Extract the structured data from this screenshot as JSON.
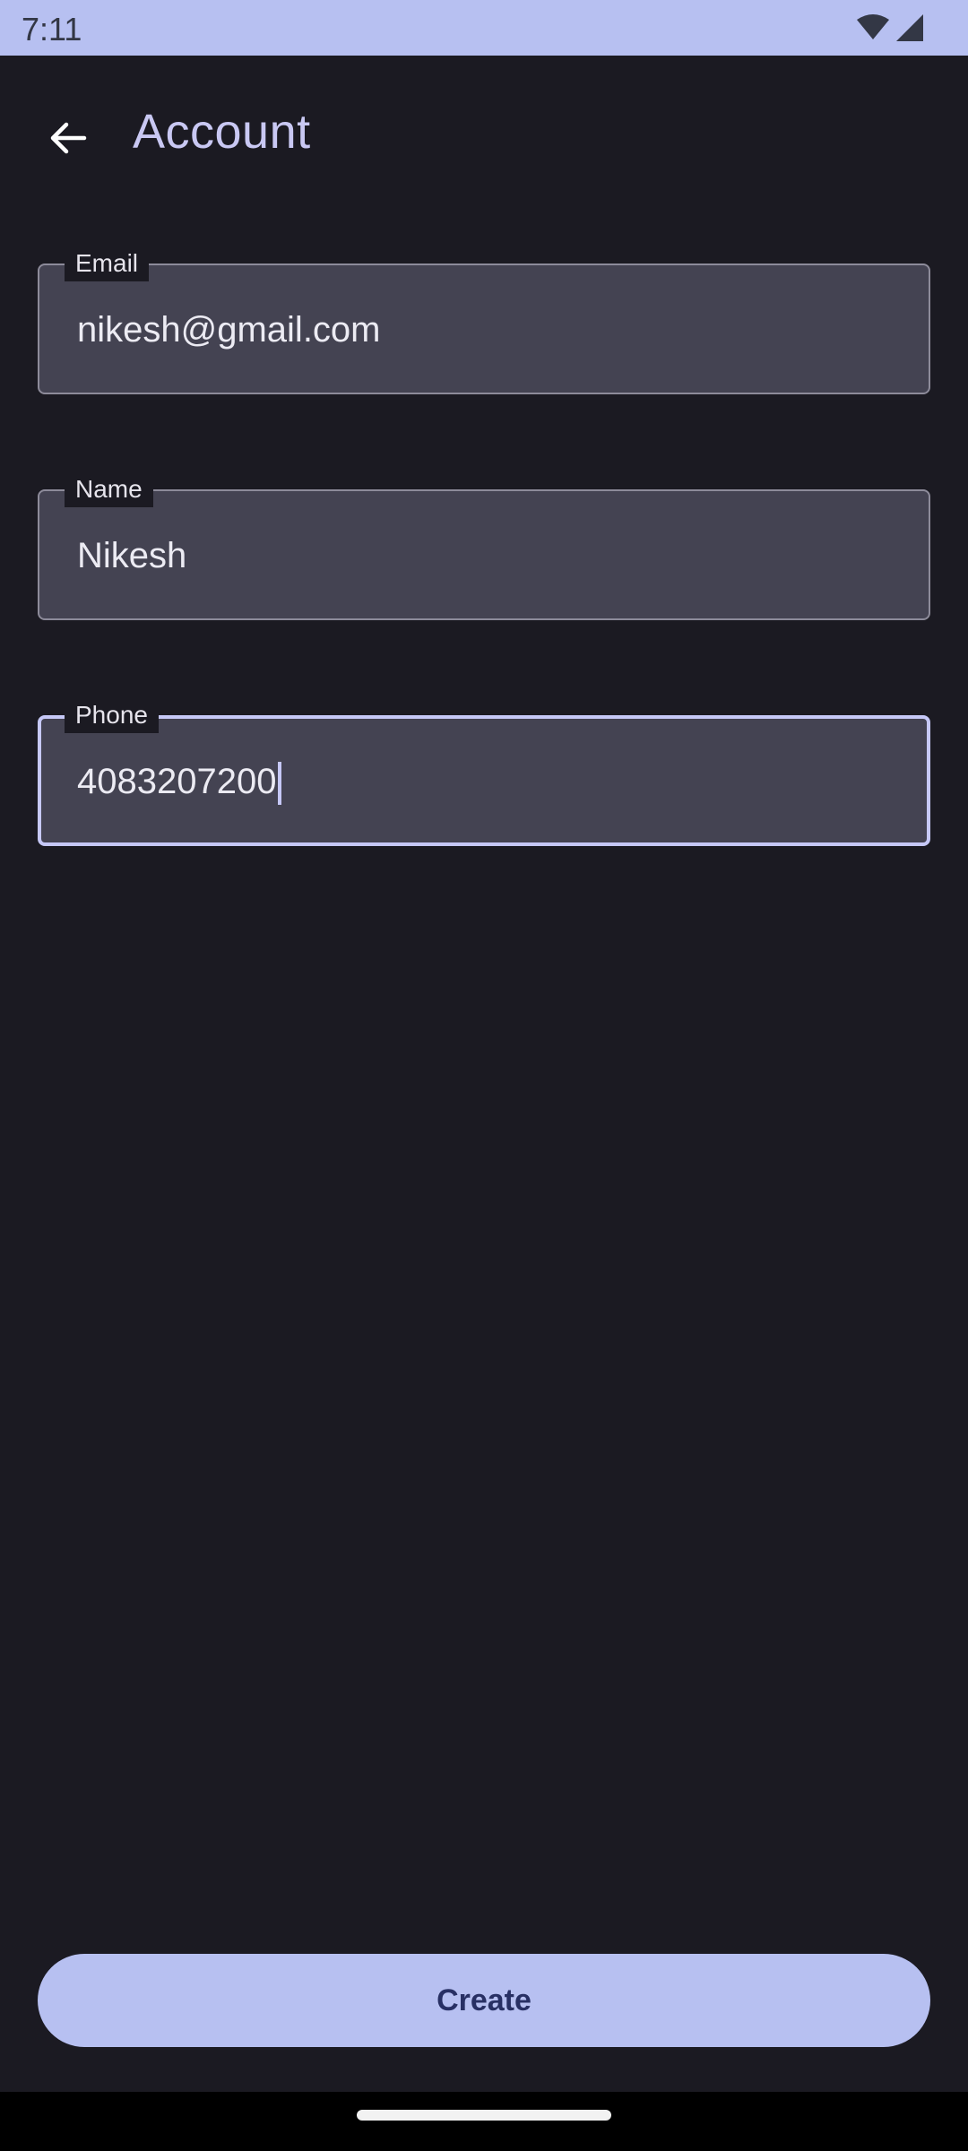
{
  "status_bar": {
    "time": "7:11",
    "icons": [
      "wifi-icon",
      "cellular-signal-icon"
    ]
  },
  "top_bar": {
    "title": "Account",
    "back_icon": "arrow-back-icon"
  },
  "form": {
    "email": {
      "label": "Email",
      "value": "nikesh@gmail.com"
    },
    "name": {
      "label": "Name",
      "value": "Nikesh"
    },
    "phone": {
      "label": "Phone",
      "value": "4083207200",
      "focused": true
    }
  },
  "actions": {
    "create_label": "Create"
  },
  "colors": {
    "background": "#1b1a22",
    "accent": "#b7c0f1",
    "title_text": "#c9c8f3",
    "field_fill": "#444352",
    "focused_outline": "#c6c8f7"
  }
}
